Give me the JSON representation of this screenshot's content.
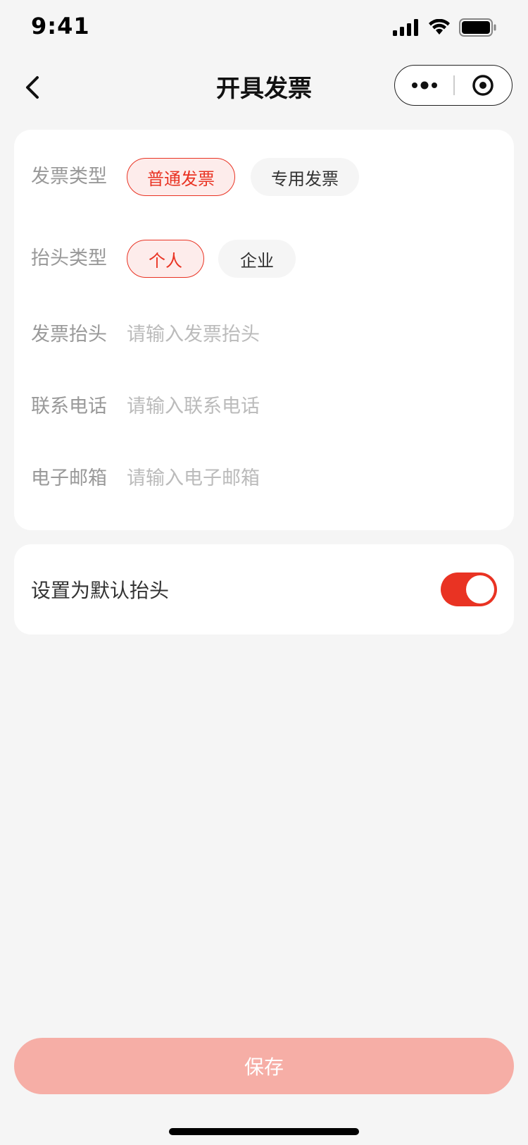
{
  "status": {
    "time": "9:41"
  },
  "nav": {
    "title": "开具发票"
  },
  "form": {
    "invoice_type": {
      "label": "发票类型",
      "options": [
        {
          "label": "普通发票",
          "selected": true
        },
        {
          "label": "专用发票",
          "selected": false
        }
      ]
    },
    "header_type": {
      "label": "抬头类型",
      "options": [
        {
          "label": "个人",
          "selected": true
        },
        {
          "label": "企业",
          "selected": false
        }
      ]
    },
    "invoice_header": {
      "label": "发票抬头",
      "placeholder": "请输入发票抬头",
      "value": ""
    },
    "phone": {
      "label": "联系电话",
      "placeholder": "请输入联系电话",
      "value": ""
    },
    "email": {
      "label": "电子邮箱",
      "placeholder": "请输入电子邮箱",
      "value": ""
    }
  },
  "default_header": {
    "label": "设置为默认抬头",
    "enabled": true
  },
  "actions": {
    "save_label": "保存"
  },
  "colors": {
    "accent": "#e93323",
    "save_disabled": "#f6aea6",
    "background": "#f5f5f5"
  }
}
